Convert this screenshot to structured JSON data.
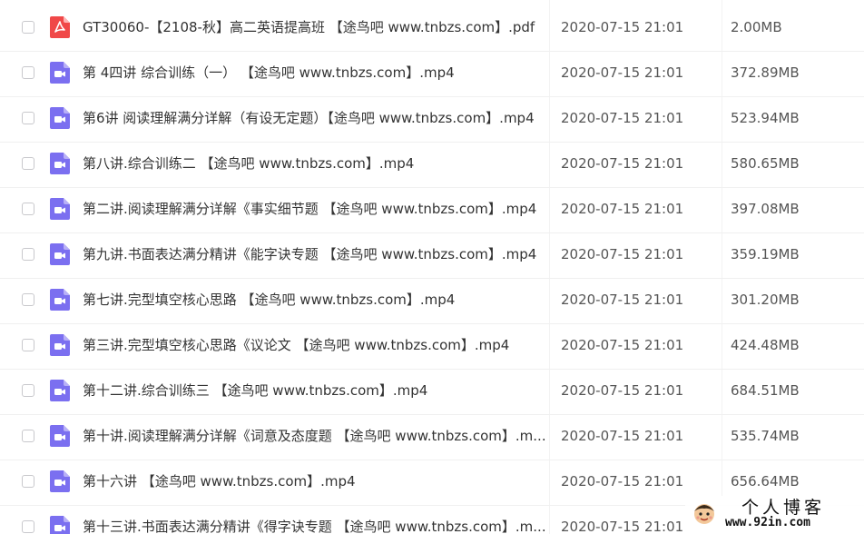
{
  "files": [
    {
      "name": "GT30060-【2108-秋】高二英语提高班 【途鸟吧 www.tnbzs.com】.pdf",
      "date": "2020-07-15 21:01",
      "size": "2.00MB",
      "type": "pdf",
      "icon": "pdf-file-icon"
    },
    {
      "name": "第 4四讲 综合训练（一）  【途鸟吧 www.tnbzs.com】.mp4",
      "date": "2020-07-15 21:01",
      "size": "372.89MB",
      "type": "video",
      "icon": "video-file-icon"
    },
    {
      "name": "第6讲 阅读理解满分详解（有设无定题）【途鸟吧 www.tnbzs.com】.mp4",
      "date": "2020-07-15 21:01",
      "size": "523.94MB",
      "type": "video",
      "icon": "video-file-icon"
    },
    {
      "name": "第八讲.综合训练二 【途鸟吧 www.tnbzs.com】.mp4",
      "date": "2020-07-15 21:01",
      "size": "580.65MB",
      "type": "video",
      "icon": "video-file-icon"
    },
    {
      "name": "第二讲.阅读理解满分详解《事实细节题 【途鸟吧 www.tnbzs.com】.mp4",
      "date": "2020-07-15 21:01",
      "size": "397.08MB",
      "type": "video",
      "icon": "video-file-icon"
    },
    {
      "name": "第九讲.书面表达满分精讲《能字诀专题 【途鸟吧 www.tnbzs.com】.mp4",
      "date": "2020-07-15 21:01",
      "size": "359.19MB",
      "type": "video",
      "icon": "video-file-icon"
    },
    {
      "name": "第七讲.完型填空核心思路 【途鸟吧 www.tnbzs.com】.mp4",
      "date": "2020-07-15 21:01",
      "size": "301.20MB",
      "type": "video",
      "icon": "video-file-icon"
    },
    {
      "name": "第三讲.完型填空核心思路《议论文 【途鸟吧 www.tnbzs.com】.mp4",
      "date": "2020-07-15 21:01",
      "size": "424.48MB",
      "type": "video",
      "icon": "video-file-icon"
    },
    {
      "name": "第十二讲.综合训练三 【途鸟吧 www.tnbzs.com】.mp4",
      "date": "2020-07-15 21:01",
      "size": "684.51MB",
      "type": "video",
      "icon": "video-file-icon"
    },
    {
      "name": "第十讲.阅读理解满分详解《词意及态度题 【途鸟吧 www.tnbzs.com】.m...",
      "date": "2020-07-15 21:01",
      "size": "535.74MB",
      "type": "video",
      "icon": "video-file-icon"
    },
    {
      "name": "第十六讲 【途鸟吧 www.tnbzs.com】.mp4",
      "date": "2020-07-15 21:01",
      "size": "656.64MB",
      "type": "video",
      "icon": "video-file-icon"
    },
    {
      "name": "第十三讲.书面表达满分精讲《得字诀专题 【途鸟吧 www.tnbzs.com】.m...",
      "date": "2020-07-15 21:01",
      "size": "",
      "type": "video",
      "icon": "video-file-icon"
    }
  ],
  "watermark": {
    "title": "个人博客",
    "url": "www.92in.com"
  },
  "colors": {
    "pdf_icon": "#f04848",
    "video_icon": "#7b6ff0",
    "text": "#333333",
    "muted_text": "#555555",
    "divider": "#f0f0f0"
  }
}
